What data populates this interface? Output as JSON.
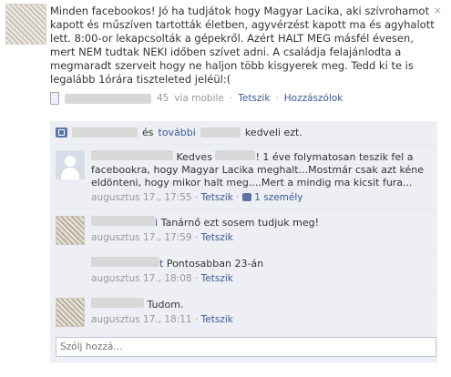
{
  "close": "×",
  "post": {
    "text": "Minden facebookos! Jó ha tudjátok hogy Magyar Lacika, aki szívrohamot kapott és műszíven tartották életben, agyvérzést kapott ma és agyhalott lett. 8:00-or lekapcsolták a gépekről. Azért HALT MEG másfél évesen, mert NEM tudtak NEKI időben szívet adni. A családja felajánlodta a megmaradt szerveit hogy ne haljon több kisgyerek meg. Tedd ki te is legalább 1órára tiszteleted jeléül:(",
    "time_fragment": "45",
    "via": "via mobile",
    "like_label": "Tetszik",
    "comment_label": "Hozzászólok"
  },
  "likes": {
    "and_text": "és",
    "others": "további",
    "suffix": "kedveli ezt."
  },
  "comments": [
    {
      "text_prefix": "Kedves",
      "text_suffix": "! 1 éve folymatosan teszik fel a facebookra, hogy Magyar Lacika meghalt...Mostmár csak azt kéne eldönteni, hogy mikor halt meg....Mert a mindig ma kicsit fura...",
      "date": "augusztus 17., 17:55",
      "like_label": "Tetszik",
      "likes_count": "1 személy"
    },
    {
      "name_end": "i",
      "text": "Tanárnő ezt sosem tudjuk meg!",
      "date": "augusztus 17., 17:59",
      "like_label": "Tetszik"
    },
    {
      "name_end": "t",
      "text": "Pontosabban 23-án",
      "date": "augusztus 17., 18:08",
      "like_label": "Tetszik"
    },
    {
      "text": "Tudom.",
      "date": "augusztus 17., 18:11",
      "like_label": "Tetszik"
    }
  ],
  "comment_box": {
    "placeholder": "Szólj hozzá..."
  }
}
